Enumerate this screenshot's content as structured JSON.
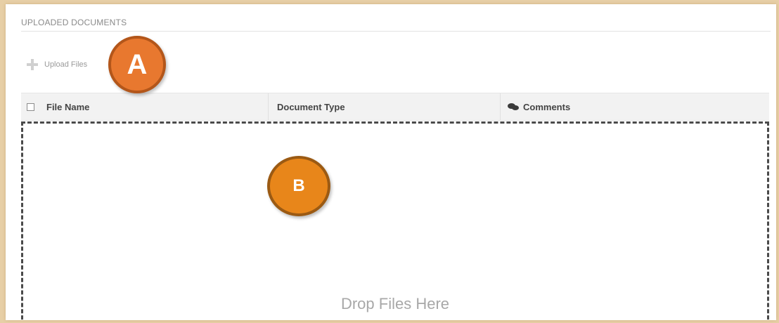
{
  "section": {
    "title": "UPLOADED DOCUMENTS"
  },
  "toolbar": {
    "upload_label": "Upload Files",
    "upload_icon": "plus-icon"
  },
  "annotations": {
    "a": "A",
    "b": "B"
  },
  "table": {
    "columns": [
      "File Name",
      "Document Type",
      "Comments"
    ],
    "comments_icon": "comments-icon"
  },
  "dropzone": {
    "text": "Drop Files Here"
  },
  "colors": {
    "badge_a": "#e8782f",
    "badge_b": "#e8861a",
    "frame_border": "#e7cfa6"
  }
}
